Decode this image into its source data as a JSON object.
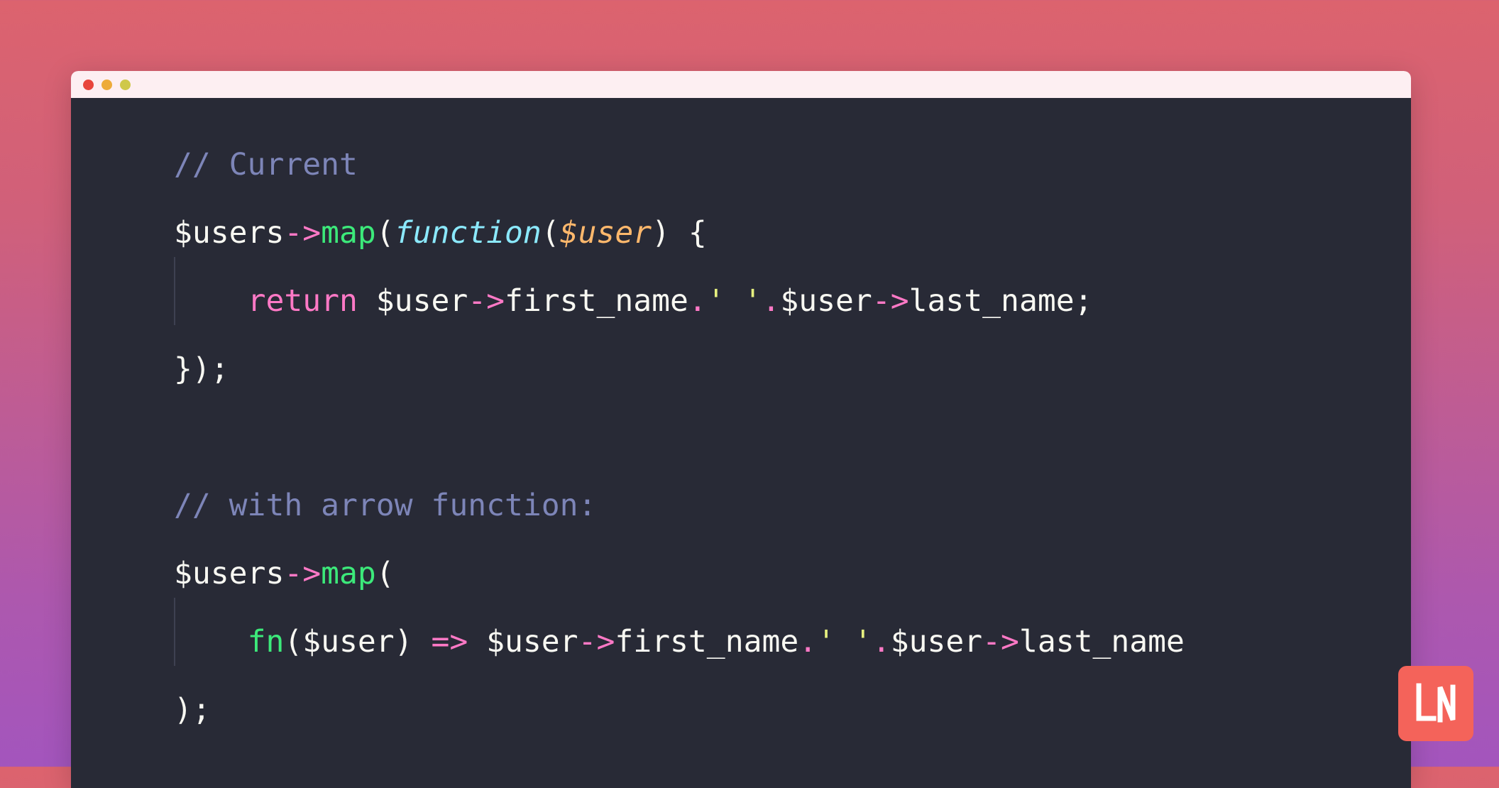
{
  "background": {
    "gradient_from": "#dc636e",
    "gradient_to": "#a355bd",
    "direction": "vertical"
  },
  "window": {
    "titlebar_color": "#fdeff2",
    "editor_background": "#282a36",
    "traffic_lights": [
      {
        "name": "close",
        "color": "#e8453c"
      },
      {
        "name": "minimize",
        "color": "#edab3a"
      },
      {
        "name": "maximize",
        "color": "#cfc84a"
      }
    ]
  },
  "code": {
    "language": "php",
    "theme": "dracula",
    "full_text": "// Current\n$users->map(function($user) {\n    return $user->first_name.' '.$user->last_name;\n});\n\n// with arrow function:\n$users->map(\n    fn($user) => $user->first_name.' '.$user->last_name\n);",
    "lines": [
      {
        "index": 1,
        "indent": false,
        "text": "// Current",
        "tokens": [
          {
            "t": "// Current",
            "c": "comment"
          }
        ]
      },
      {
        "index": 2,
        "indent": false,
        "text": "$users->map(function($user) {",
        "tokens": [
          {
            "t": "$users",
            "c": "plain"
          },
          {
            "t": "->",
            "c": "op"
          },
          {
            "t": "map",
            "c": "fn"
          },
          {
            "t": "(",
            "c": "punct"
          },
          {
            "t": "function",
            "c": "type"
          },
          {
            "t": "(",
            "c": "punct"
          },
          {
            "t": "$user",
            "c": "param"
          },
          {
            "t": ")",
            "c": "punct"
          },
          {
            "t": " {",
            "c": "punct"
          }
        ]
      },
      {
        "index": 3,
        "indent": true,
        "text": "    return $user->first_name.' '.$user->last_name;",
        "tokens": [
          {
            "t": "    ",
            "c": "plain"
          },
          {
            "t": "return",
            "c": "kw"
          },
          {
            "t": " $user",
            "c": "plain"
          },
          {
            "t": "->",
            "c": "op"
          },
          {
            "t": "first_name",
            "c": "plain"
          },
          {
            "t": ".",
            "c": "op"
          },
          {
            "t": "' '",
            "c": "string"
          },
          {
            "t": ".",
            "c": "op"
          },
          {
            "t": "$user",
            "c": "plain"
          },
          {
            "t": "->",
            "c": "op"
          },
          {
            "t": "last_name;",
            "c": "plain"
          }
        ]
      },
      {
        "index": 4,
        "indent": false,
        "text": "});",
        "tokens": [
          {
            "t": "});",
            "c": "punct"
          }
        ]
      },
      {
        "index": 5,
        "indent": false,
        "text": "",
        "tokens": []
      },
      {
        "index": 6,
        "indent": false,
        "text": "// with arrow function:",
        "tokens": [
          {
            "t": "// with arrow function:",
            "c": "comment"
          }
        ]
      },
      {
        "index": 7,
        "indent": false,
        "text": "$users->map(",
        "tokens": [
          {
            "t": "$users",
            "c": "plain"
          },
          {
            "t": "->",
            "c": "op"
          },
          {
            "t": "map",
            "c": "fn"
          },
          {
            "t": "(",
            "c": "punct"
          }
        ]
      },
      {
        "index": 8,
        "indent": true,
        "text": "    fn($user) => $user->first_name.' '.$user->last_name",
        "tokens": [
          {
            "t": "    ",
            "c": "plain"
          },
          {
            "t": "fn",
            "c": "fn"
          },
          {
            "t": "($user)",
            "c": "plain"
          },
          {
            "t": " ",
            "c": "plain"
          },
          {
            "t": "=>",
            "c": "op"
          },
          {
            "t": " $user",
            "c": "plain"
          },
          {
            "t": "->",
            "c": "op"
          },
          {
            "t": "first_name",
            "c": "plain"
          },
          {
            "t": ".",
            "c": "op"
          },
          {
            "t": "' '",
            "c": "string"
          },
          {
            "t": ".",
            "c": "op"
          },
          {
            "t": "$user",
            "c": "plain"
          },
          {
            "t": "->",
            "c": "op"
          },
          {
            "t": "last_name",
            "c": "plain"
          }
        ]
      },
      {
        "index": 9,
        "indent": false,
        "text": ");",
        "tokens": [
          {
            "t": ");",
            "c": "punct"
          }
        ]
      }
    ],
    "token_colors": {
      "comment": "#7d85b8",
      "plain": "#f8f8f2",
      "punct": "#f8f8f2",
      "op": "#ff79c6",
      "kw": "#ff79c6",
      "fn": "#3ce97a",
      "type": "#8be9fd",
      "param": "#ffb86c",
      "string": "#e6f07f"
    }
  },
  "logo": {
    "text": "LN",
    "background_color": "#f4635a",
    "text_color": "#ffffff"
  }
}
